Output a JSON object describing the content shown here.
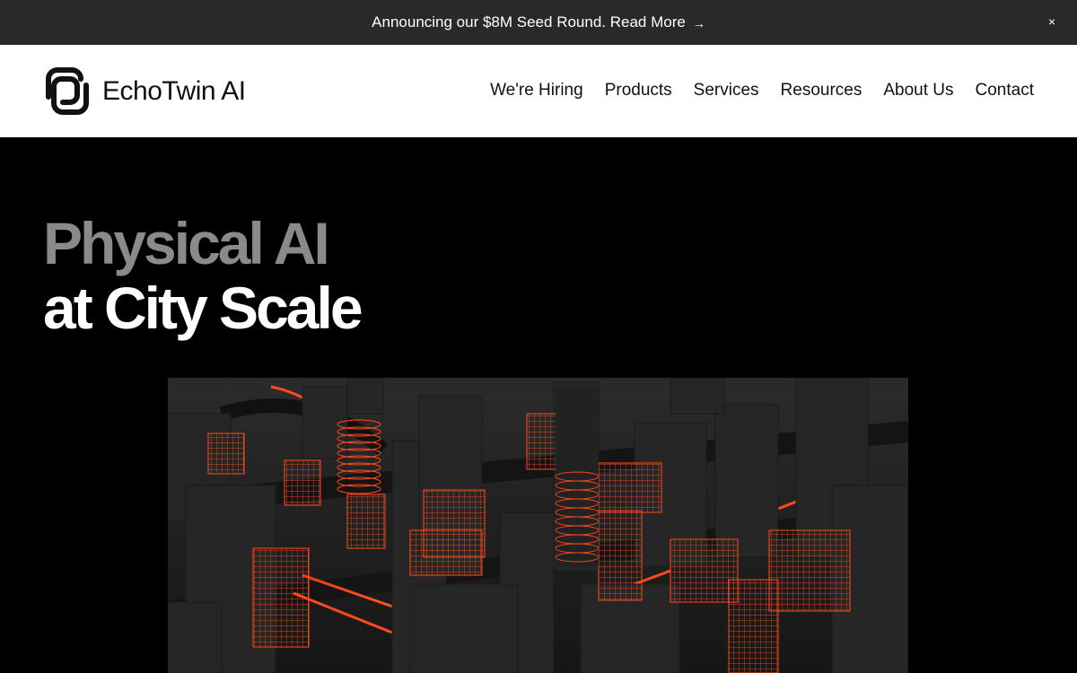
{
  "announcement": {
    "text": "Announcing our $8M Seed Round. Read More",
    "arrow": "→",
    "close_icon": "close-icon",
    "close_glyph": "×"
  },
  "header": {
    "brand": "EchoTwin AI",
    "logo_icon": "echotwin-logo-icon",
    "nav": [
      "We're Hiring",
      "Products",
      "Services",
      "Resources",
      "About Us",
      "Contact"
    ]
  },
  "hero": {
    "title_line1": "Physical AI",
    "title_line2": "at City Scale",
    "image": "3d-city-render-image",
    "accent": "#ff4a1c"
  }
}
